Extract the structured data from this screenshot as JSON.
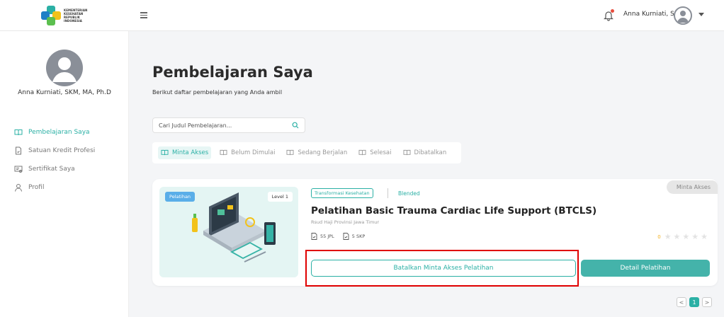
{
  "header": {
    "logo_lines": [
      "KEMENTERIAN",
      "KESEHATAN",
      "REPUBLIK",
      "INDONESIA"
    ],
    "user_name": "Anna Kurniati, S ...",
    "icons": [
      "hamburger-icon",
      "bell-icon",
      "avatar",
      "caret-down-icon"
    ]
  },
  "sidebar": {
    "user_name": "Anna Kurniati, SKM, MA, Ph.D",
    "items": [
      {
        "label": "Pembelajaran Saya",
        "icon": "book-open-icon",
        "active": true
      },
      {
        "label": "Satuan Kredit Profesi",
        "icon": "document-icon",
        "active": false
      },
      {
        "label": "Sertifikat Saya",
        "icon": "certificate-icon",
        "active": false
      },
      {
        "label": "Profil",
        "icon": "user-icon",
        "active": false
      }
    ]
  },
  "main": {
    "title": "Pembelajaran Saya",
    "subtitle": "Berikut daftar pembelajaran yang Anda ambil",
    "search": {
      "placeholder": "Cari Judul Pembelajaran..."
    },
    "tabs": [
      {
        "label": "Minta Akses",
        "active": true
      },
      {
        "label": "Belum Dimulai",
        "active": false
      },
      {
        "label": "Sedang Berjalan",
        "active": false
      },
      {
        "label": "Selesai",
        "active": false
      },
      {
        "label": "Dibatalkan",
        "active": false
      }
    ]
  },
  "course": {
    "badge_type": "Pelatihan",
    "badge_level": "Level 1",
    "tag_category": "Transformasi Kesehatan",
    "tag_mode": "Blended",
    "status": "Minta Akses",
    "title": "Pelatihan Basic Trauma Cardiac Life Support (BTCLS)",
    "organizer": "Rsud Haji Provinsi Jawa Timur",
    "jpl": "55 JPL",
    "skp": "5 SKP",
    "rating": "0",
    "stars": 0,
    "cancel_label": "Batalkan Minta Akses Pelatihan",
    "detail_label": "Detail Pelatihan"
  },
  "pagination": {
    "prev": "<",
    "current": "1",
    "next": ">"
  },
  "colors": {
    "accent": "#2bb0a5",
    "highlight": "#e00000",
    "badge_blue": "#5aaee8"
  }
}
